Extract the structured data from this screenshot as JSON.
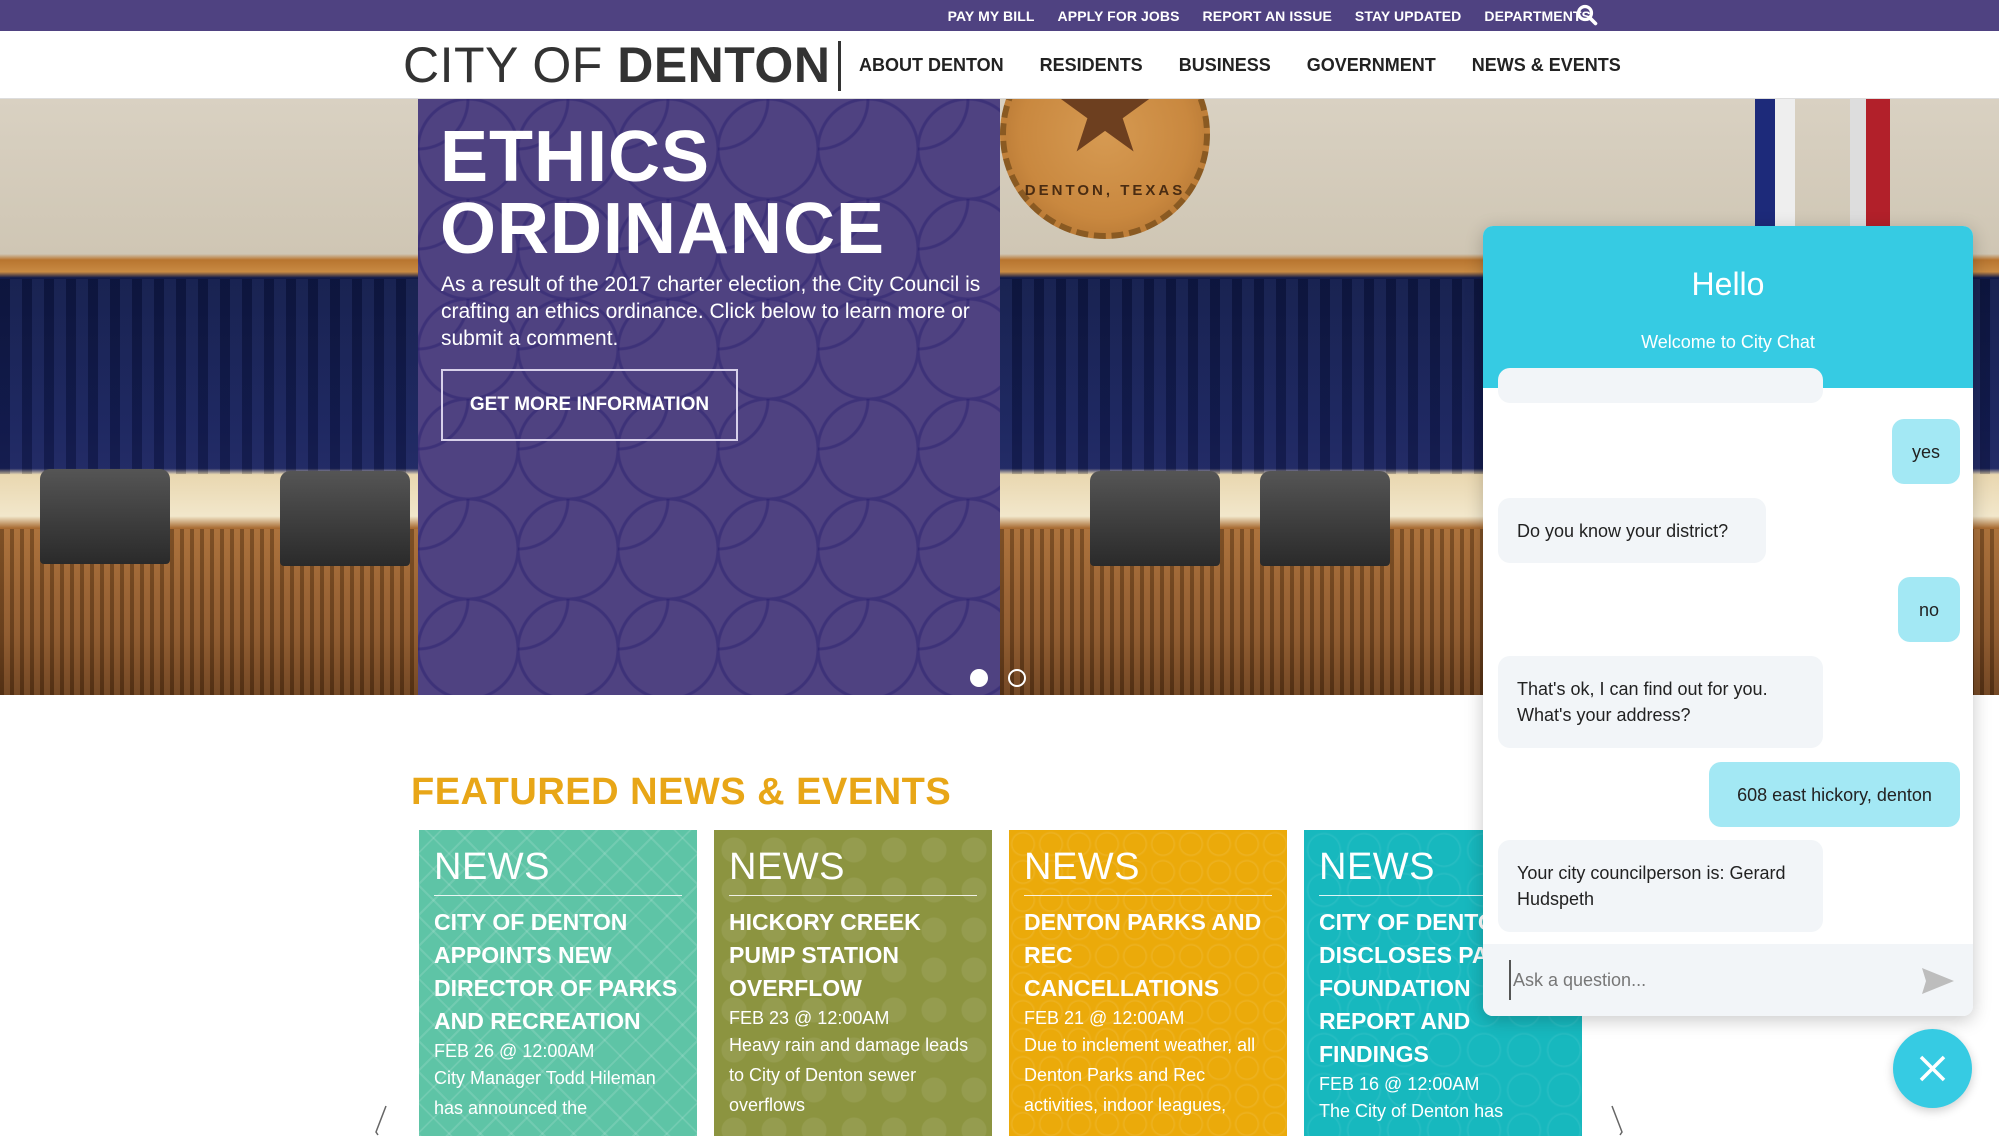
{
  "utility_bar": {
    "links": [
      "PAY MY BILL",
      "APPLY FOR JOBS",
      "REPORT AN ISSUE",
      "STAY UPDATED",
      "DEPARTMENTS"
    ],
    "search_icon": "search-icon"
  },
  "header": {
    "logo_light": "CITY OF ",
    "logo_bold": "DENTON",
    "nav": [
      "ABOUT DENTON",
      "RESIDENTS",
      "BUSINESS",
      "GOVERNMENT",
      "NEWS & EVENTS"
    ]
  },
  "hero": {
    "title_line1": "ETHICS",
    "title_line2": "ORDINANCE",
    "body": "As a result of the 2017 charter election, the City Council is crafting an ethics ordinance. Click below to learn more or submit a comment.",
    "cta_label": "GET MORE INFORMATION",
    "seal_text": "DENTON, TEXAS",
    "slides_total": 2,
    "active_slide": 1,
    "panel_color": "#4f4281"
  },
  "featured": {
    "title": "FEATURED NEWS & EVENTS",
    "title_color": "#e8a617",
    "cards": [
      {
        "kicker": "NEWS",
        "headline": "CITY OF DENTON APPOINTS NEW DIRECTOR OF PARKS AND RECREATION",
        "date": "FEB 26 @ 12:00AM",
        "excerpt": "City Manager Todd Hileman has announced the",
        "color": "#5ec4a6"
      },
      {
        "kicker": "NEWS",
        "headline": "HICKORY CREEK PUMP STATION OVERFLOW",
        "date": "FEB 23 @ 12:00AM",
        "excerpt": "Heavy rain and damage leads to City of Denton sewer overflows",
        "color": "#8c9440"
      },
      {
        "kicker": "NEWS",
        "headline": "DENTON PARKS AND REC CANCELLATIONS",
        "date": "FEB 21 @ 12:00AM",
        "excerpt": "Due to inclement weather, all Denton Parks and Rec activities, indoor leagues,",
        "color": "#ebaa0a"
      },
      {
        "kicker": "NEWS",
        "headline": "CITY OF DENTON DISCLOSES PARKS FOUNDATION REPORT AND FINDINGS",
        "date": "FEB 16 @ 12:00AM",
        "excerpt": "The City of Denton has",
        "color": "#17b8be"
      }
    ]
  },
  "chat": {
    "title": "Hello",
    "subtitle": "Welcome to City Chat",
    "accent_color": "#36cbe3",
    "messages": [
      {
        "from": "user",
        "text": "yes"
      },
      {
        "from": "bot",
        "text": "Do you know your district?"
      },
      {
        "from": "user",
        "text": "no"
      },
      {
        "from": "bot",
        "text": "That's ok, I can find out for you. What's your address?"
      },
      {
        "from": "user",
        "text": "608 east hickory, denton"
      },
      {
        "from": "bot",
        "text": "Your city councilperson is: Gerard Hudspeth"
      }
    ],
    "input_placeholder": "Ask a question...",
    "input_value": ""
  }
}
